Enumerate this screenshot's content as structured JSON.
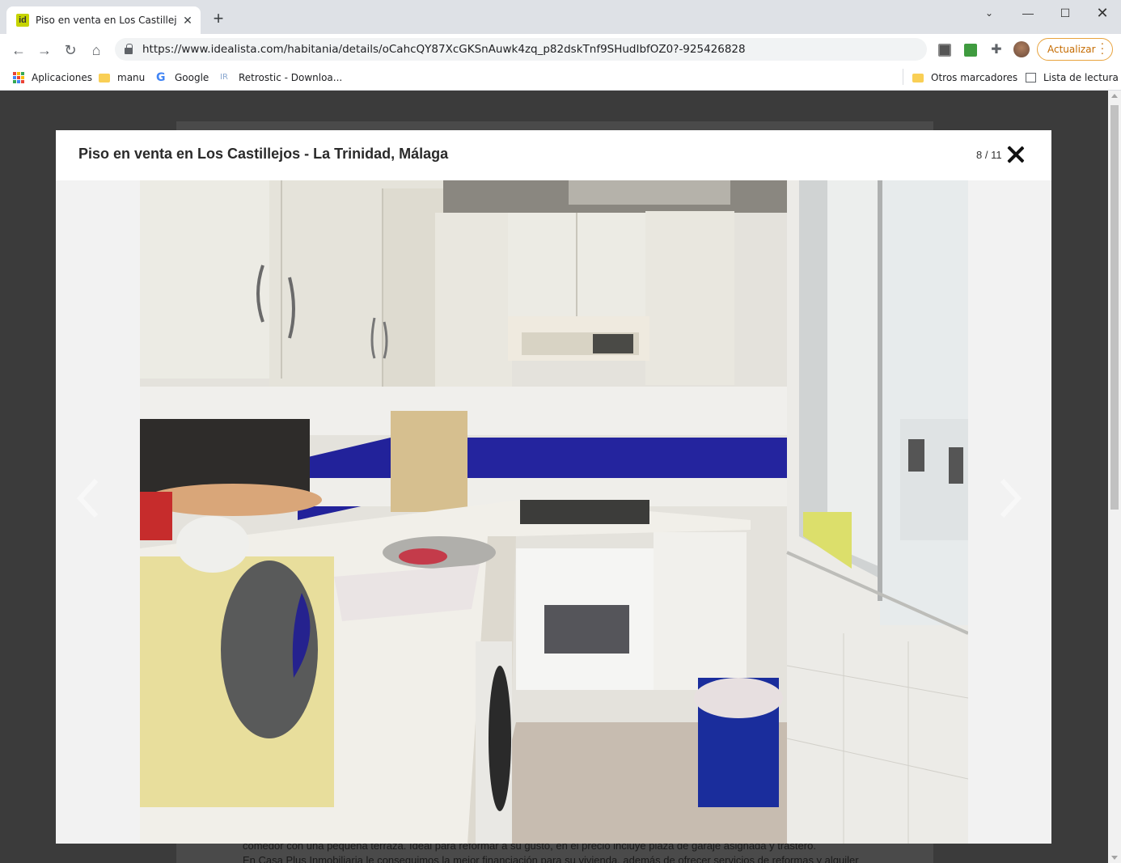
{
  "browser": {
    "tab_title": "Piso en venta en Los Castillejos -",
    "favicon_text": "id",
    "url": "https://www.idealista.com/habitania/details/oCahcQY87XcGKSnAuwk4zq_p82dskTnf9SHudIbfOZ0?-925426828",
    "update_button": "Actualizar",
    "bookmarks": [
      {
        "label": "Aplicaciones",
        "icon": "apps-icon"
      },
      {
        "label": "manu",
        "icon": "folder-icon"
      },
      {
        "label": "Google",
        "icon": "google-icon"
      },
      {
        "label": "Retrostic - Downloa...",
        "icon": "retrostic-icon"
      }
    ],
    "other_bookmarks": "Otros marcadores",
    "reading_list": "Lista de lectura"
  },
  "modal": {
    "title": "Piso en venta en Los Castillejos - La Trinidad, Málaga",
    "counter": "8 / 11",
    "photo_alt": "kitchen photo"
  },
  "background": {
    "description_line1": "comedor con una pequeña terraza. Ideal para reformar a su gusto, en el precio incluye plaza de garaje asignada y trastero.",
    "description_line2": "En Casa Plus Inmobiliaria le conseguimos la mejor financiación para su vivienda, además de ofrecer servicios de reformas y alquiler"
  },
  "colors": {
    "accent_update": "#c56b00",
    "modal_bg": "#f2f2f2",
    "overlay": "#3c3c3c",
    "tile_blue": "#2a2aa0"
  }
}
